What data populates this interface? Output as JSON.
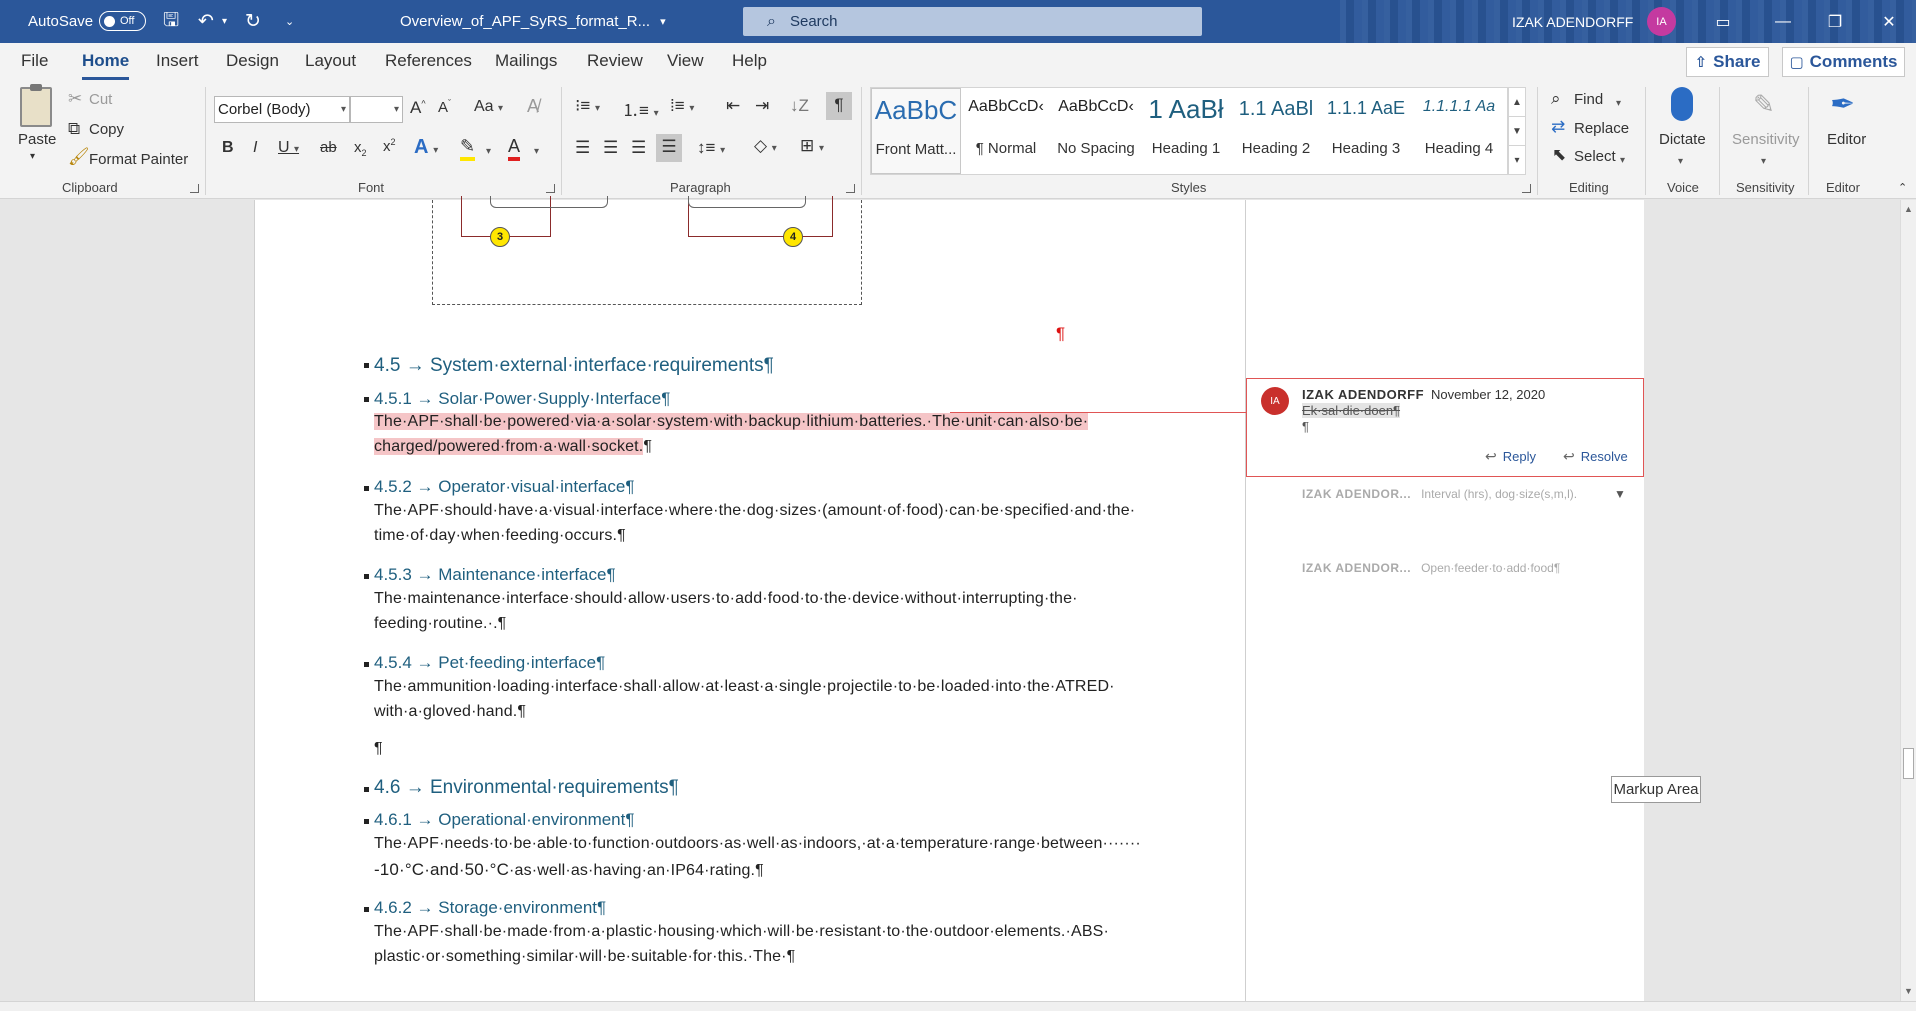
{
  "titlebar": {
    "autosave_label": "AutoSave",
    "autosave_state": "Off",
    "doc_title": "Overview_of_APF_SyRS_format_R...",
    "search_placeholder": "Search",
    "user_name": "IZAK ADENDORFF",
    "user_initials": "IA"
  },
  "tabs": [
    "File",
    "Home",
    "Insert",
    "Design",
    "Layout",
    "References",
    "Mailings",
    "Review",
    "View",
    "Help"
  ],
  "active_tab": "Home",
  "share_label": "Share",
  "comments_label": "Comments",
  "clipboard": {
    "paste": "Paste",
    "cut": "Cut",
    "copy": "Copy",
    "format_painter": "Format Painter",
    "group": "Clipboard"
  },
  "font": {
    "name": "Corbel (Body)",
    "size": "",
    "group": "Font"
  },
  "paragraph": {
    "group": "Paragraph"
  },
  "styles": {
    "group": "Styles",
    "items": [
      {
        "preview": "AaBbC",
        "name": "Front Matt..."
      },
      {
        "preview": "AaBbCcD‹",
        "name": "¶ Normal"
      },
      {
        "preview": "AaBbCcD‹",
        "name": "No Spacing"
      },
      {
        "preview": "1 AaBł",
        "name": "Heading 1"
      },
      {
        "preview": "1.1 AaBl",
        "name": "Heading 2"
      },
      {
        "preview": "1.1.1 AaE",
        "name": "Heading 3"
      },
      {
        "preview": "1.1.1.1 Aa",
        "name": "Heading 4"
      }
    ]
  },
  "editing": {
    "find": "Find",
    "replace": "Replace",
    "select": "Select",
    "group": "Editing"
  },
  "voice": {
    "dictate": "Dictate",
    "group": "Voice"
  },
  "sensitivity": {
    "label": "Sensitivity",
    "group": "Sensitivity"
  },
  "editor": {
    "label": "Editor",
    "group": "Editor"
  },
  "document": {
    "diagram_nodes": [
      "3",
      "4"
    ],
    "pilcrow": "¶",
    "h_4_5": "4.5 → System·external·interface·requirements¶",
    "h_4_5_1": "4.5.1 → Solar·Power·Supply·Interface¶",
    "p_4_5_1_a": "The·APF·shall·be·powered·via·a·solar·system·with·backup·lithium·batteries.·The·unit·can·also·be·",
    "p_4_5_1_b": "charged/powered·from·a·wall·socket.",
    "h_4_5_2": "4.5.2 → Operator·visual·interface¶",
    "p_4_5_2_a": "The·APF·should·have·a·visual·interface·where·the·dog·sizes·(amount·of·food)·can·be·specified·and·the·",
    "p_4_5_2_b": "time·of·day·when·feeding·occurs.¶",
    "h_4_5_3": "4.5.3 → Maintenance·interface¶",
    "p_4_5_3_a": "The·maintenance·interface·should·allow·users·to·add·food·to·the·device·without·interrupting·the·",
    "p_4_5_3_b": "feeding·routine.·.¶",
    "h_4_5_4": "4.5.4 → Pet·feeding·interface¶",
    "p_4_5_4_a": "The·ammunition·loading·interface·shall·allow·at·least·a·single·projectile·to·be·loaded·into·the·ATRED·",
    "p_4_5_4_b": "with·a·gloved·hand.¶",
    "h_4_6": "4.6 → Environmental·requirements¶",
    "h_4_6_1": "4.6.1 → Operational·environment¶",
    "p_4_6_1_a": "The·APF·needs·to·be·able·to·function·outdoors·as·well·as·indoors,·at·a·temperature·range·between·······",
    "p_4_6_1_b1": "-10·°C·and·50·°C",
    "p_4_6_1_b2": "·as·well·as·having·an·IP64·rating.¶",
    "h_4_6_2": "4.6.2 → Storage·environment¶",
    "p_4_6_2_a": "The·APF·shall·be·made·from·a·plastic·housing·which·will·be·resistant·to·the·outdoor·elements.·ABS·",
    "p_4_6_2_b": "plastic·or·something·similar·will·be·suitable·for·this.·The·¶"
  },
  "comments": {
    "active": {
      "initials": "IA",
      "author": "IZAK ADENDORFF",
      "date": "November 12, 2020",
      "text": "Ek·sal·die·doen¶",
      "pilcrow": "¶",
      "reply": "Reply",
      "resolve": "Resolve"
    },
    "collapsed": [
      {
        "author": "IZAK ADENDOR...",
        "text": "Interval (hrs), dog·size(s,m,l)."
      },
      {
        "author": "IZAK ADENDOR...",
        "text": "Open·feeder·to·add·food¶"
      }
    ]
  },
  "tooltip": "Markup Area",
  "colors": {
    "titlebar": "#2b579a",
    "heading": "#1f5f7f",
    "highlight": "#f5c5c7",
    "comment_border": "#e05555"
  }
}
